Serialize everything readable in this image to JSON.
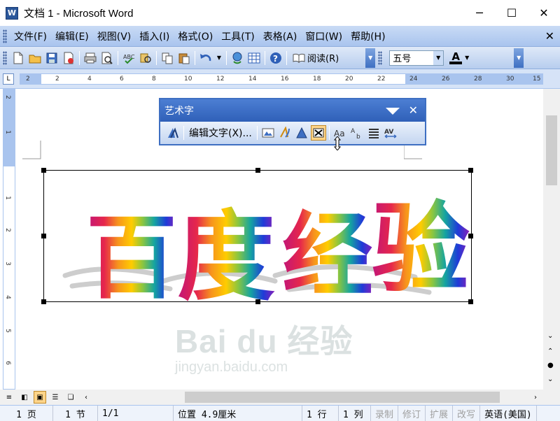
{
  "window": {
    "title": "文档 1 - Microsoft Word",
    "app_icon_label": "W",
    "controls": [
      "─",
      "☐",
      "✕"
    ]
  },
  "menubar": {
    "items": [
      "文件(F)",
      "编辑(E)",
      "视图(V)",
      "插入(I)",
      "格式(O)",
      "工具(T)",
      "表格(A)",
      "窗口(W)",
      "帮助(H)"
    ],
    "close": "✕"
  },
  "toolbar": {
    "reading_label": "阅读(R)",
    "font_size": "五号",
    "font_color_glyph": "A"
  },
  "ruler": {
    "ticks": [
      "2",
      "4",
      "2",
      "4",
      "6",
      "8",
      "10",
      "12",
      "14",
      "16",
      "18",
      "20",
      "22",
      "24",
      "26",
      "28",
      "30",
      "32",
      "15"
    ]
  },
  "vruler": {
    "ticks": [
      "2",
      "1",
      "1",
      "2",
      "3",
      "4",
      "5",
      "6"
    ]
  },
  "wordart_toolbar": {
    "title": "艺术字",
    "edit_text": "编辑文字(X)...",
    "close": "✕"
  },
  "wordart": {
    "text": [
      "百",
      "度",
      "经",
      "验"
    ],
    "colors": [
      "#d4145a",
      "#f7931e",
      "#8cc63f",
      "#2e3192"
    ]
  },
  "watermark": {
    "logo": "Bai du 经验",
    "url": "jingyan.baidu.com"
  },
  "statusbar": {
    "page": "1 页",
    "section": "1 节",
    "pages": "1/1",
    "position": "位置 4.9厘米",
    "line": "1 行",
    "column": "1 列",
    "rec": "录制",
    "trk": "修订",
    "ext": "扩展",
    "ovr": "改写",
    "language": "英语(美国)"
  }
}
